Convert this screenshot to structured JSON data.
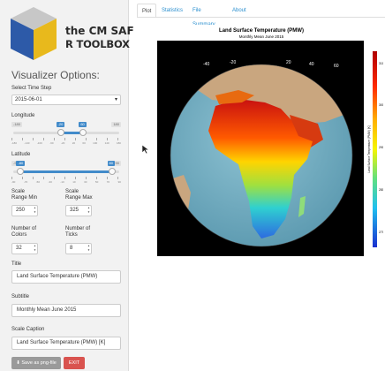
{
  "logo": {
    "line1": "the CM SAF",
    "line2": "R TOOLBOX"
  },
  "sidebar": {
    "title": "Visualizer Options:",
    "time_step": {
      "label": "Select Time Step",
      "value": "2015-06-01"
    },
    "longitude": {
      "label": "Longitude",
      "min_edge": "-180",
      "max_edge": "180",
      "low_tip": "-20",
      "high_tip": "60",
      "low": -20,
      "high": 60,
      "range": [
        -180,
        180
      ],
      "ticks": [
        "-180",
        "-140",
        "-100",
        "-60",
        "-20",
        "20",
        "60",
        "100",
        "140",
        "180"
      ]
    },
    "latitude": {
      "label": "Latitude",
      "min_edge": "-90",
      "max_edge": "90",
      "low_tip": "-80",
      "high_tip": "80",
      "low": -80,
      "high": 80,
      "range": [
        -90,
        90
      ],
      "ticks": [
        "-90",
        "-70",
        "-50",
        "-30",
        "-10",
        "10",
        "30",
        "50",
        "70",
        "90"
      ]
    },
    "scale_min": {
      "label_1": "Scale",
      "label_2": "Range Min",
      "value": "250"
    },
    "scale_max": {
      "label_1": "Scale",
      "label_2": "Range Max",
      "value": "325"
    },
    "colors": {
      "label_1": "Number of",
      "label_2": "Colors",
      "value": "32"
    },
    "ticks": {
      "label_1": "Number of",
      "label_2": "Ticks",
      "value": "8"
    },
    "title_field": {
      "label": "Title",
      "value": "Land Surface Temperature (PMW)"
    },
    "subtitle_field": {
      "label": "Subtitle",
      "value": "Monthly Mean June 2015"
    },
    "caption_field": {
      "label": "Scale Caption",
      "value": "Land Surface Temperature (PMW) [K]"
    },
    "save_button": "Save as png-file",
    "exit_button": "EXIT"
  },
  "tabs": [
    "Plot",
    "Statistics",
    "File Summary",
    "About"
  ],
  "active_tab": "Plot",
  "plot": {
    "title": "Land Surface Temperature (PMW)",
    "subtitle": "Monthly Mean June 2015",
    "caption": "Land Surface Temperature (PMW) [K]",
    "lon_labels": [
      "-40",
      "-20",
      "20",
      "40",
      "60"
    ],
    "colorbar_ticks": [
      "310",
      "300",
      "290",
      "280",
      "270"
    ],
    "colors": {
      "ocean": "#7eb5c8",
      "land": "#c8a47c",
      "hot": "#d51414",
      "cold": "#1f5fd8",
      "background": "#000000"
    }
  }
}
